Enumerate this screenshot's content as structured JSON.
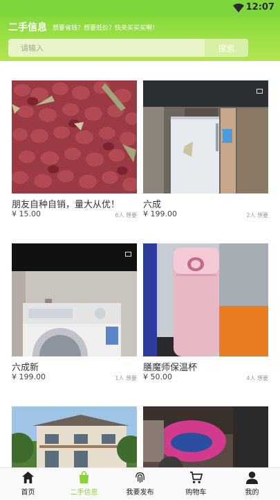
{
  "status_bar": {
    "time": "12:07"
  },
  "header": {
    "title": "二手信息",
    "slogan": "想要省钱？想要低价？快来买买买啊！"
  },
  "search": {
    "placeholder": "请输入",
    "button": "搜索"
  },
  "products": [
    {
      "name": "朋友自种自销，量大从优！",
      "price": "¥ 15.00",
      "wants": "6人 想要"
    },
    {
      "name": "六成",
      "price": "¥ 199.00",
      "wants": "2人 想要"
    },
    {
      "name": "六成新",
      "price": "¥ 199.00",
      "wants": "1人 想要"
    },
    {
      "name": "膳魔师保温杯",
      "price": "¥ 50.00",
      "wants": "4人 想要"
    }
  ],
  "tabs": [
    {
      "label": "首页",
      "icon": "home-icon"
    },
    {
      "label": "二手信息",
      "icon": "bag-icon"
    },
    {
      "label": "我要发布",
      "icon": "fingerprint-icon"
    },
    {
      "label": "购物车",
      "icon": "cart-icon"
    },
    {
      "label": "我的",
      "icon": "user-icon"
    }
  ],
  "colors": {
    "accent": "#8ad43a",
    "header": "#86d93d"
  }
}
